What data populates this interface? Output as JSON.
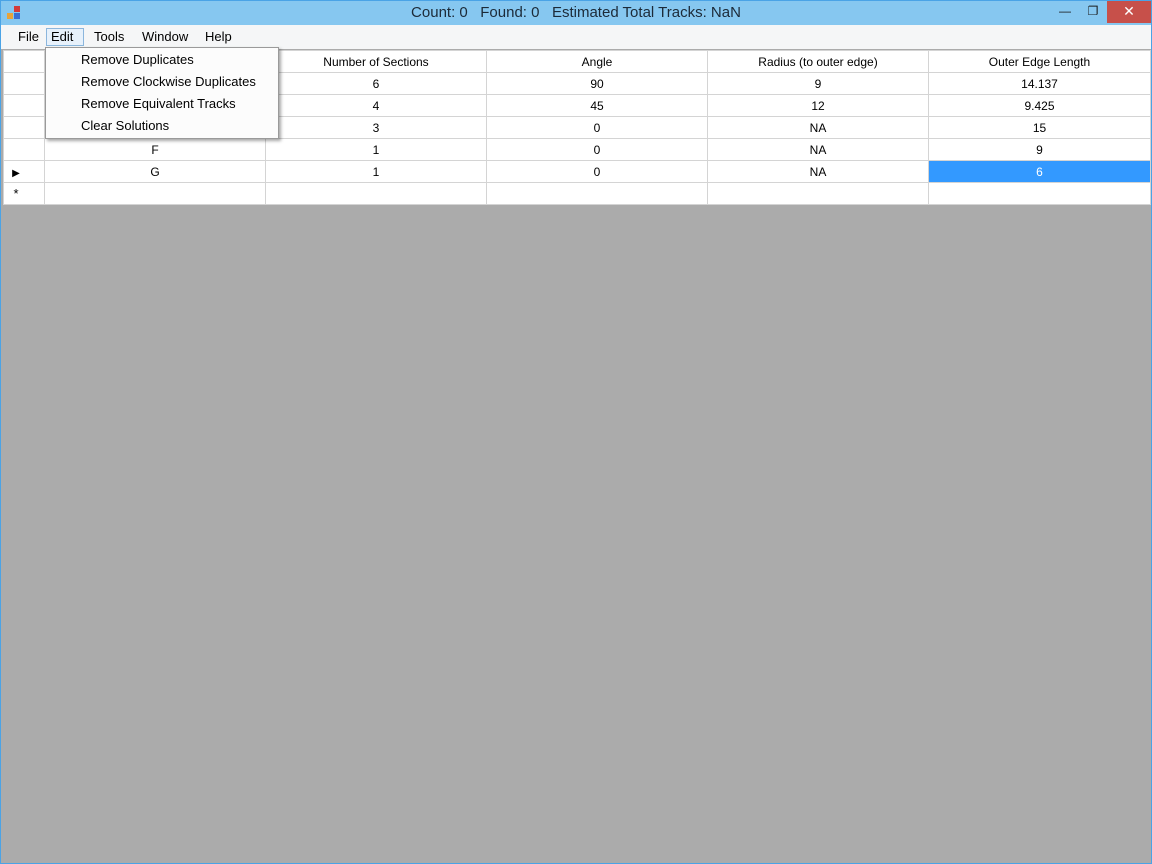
{
  "titlebar": {
    "title": "Count: 0   Found: 0   Estimated Total Tracks: NaN",
    "minimize": "—",
    "maximize": "❐",
    "close": "✕"
  },
  "menubar": {
    "file": "File",
    "edit": "Edit",
    "tools": "Tools",
    "window": "Window",
    "help": "Help"
  },
  "edit_menu": {
    "items": [
      "Remove Duplicates",
      "Remove Clockwise Duplicates",
      "Remove Equivalent Tracks",
      "Clear Solutions"
    ]
  },
  "grid": {
    "columns": [
      "",
      "Number of Sections",
      "Angle",
      "Radius (to outer edge)",
      "Outer Edge Length"
    ],
    "rows": [
      [
        "",
        "6",
        "90",
        "9",
        "14.137"
      ],
      [
        "",
        "4",
        "45",
        "12",
        "9.425"
      ],
      [
        "",
        "3",
        "0",
        "NA",
        "15"
      ],
      [
        "F",
        "1",
        "0",
        "NA",
        "9"
      ],
      [
        "G",
        "1",
        "0",
        "NA",
        "6"
      ]
    ],
    "current_row_marker": "▶",
    "new_row_marker": "*"
  },
  "colors": {
    "titlebar": "#86c7f0",
    "selection": "#3399ff",
    "background": "#ababab"
  }
}
